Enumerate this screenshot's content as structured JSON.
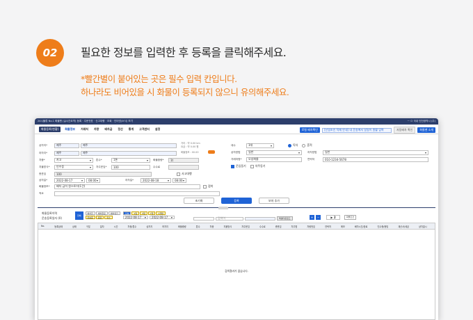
{
  "step": {
    "number": "02",
    "title": "필요한 정보를 입력한 후 등록을 클릭해주세요.",
    "note_line1": "*빨간별이 붙어있는 곳은 필수 입력 칸입니다.",
    "note_line2": "하나라도 비어있을 시 화물이 등록되지 않으니 유의해주세요."
  },
  "window": {
    "title_left": "24시물류 No.1 화물맨 (실시간요약) 등록 · 주문전표 · 신고대행 · 조회 · 인터넷(소식) 보기",
    "title_right": "ㅡ ㅁ 국내 인천광역시 (주)",
    "menu_active": "화물등록(현황)",
    "menus": [
      "화물정보",
      "거래처",
      "차량",
      "배차금",
      "정산",
      "통계",
      "고객센터",
      "설정"
    ],
    "menu_btn1": "로컬 배차확인",
    "search_text": "[신일조인 적재 안내] 내 운송에서 일일이 원활 입력",
    "menu_btn2": "자동배차 확인",
    "menu_btn3": "화물맨 소개"
  },
  "form": {
    "start_label": "상차지*",
    "start_v1": "제주",
    "start_v2": "제주",
    "end_label": "하차지*",
    "end_v1": "제주",
    "end_v2": "제주",
    "info1": "거리 : 약 0.00 km",
    "info2": "요금 : 약 0.00 원",
    "info3": "화물정보 : 00.00",
    "car_label": "차종*",
    "car_value": "카고",
    "ton_label": "톤수*",
    "ton_value": "1톤",
    "weight_label": "화물중량*",
    "weight_value": "1t",
    "pay_label": "지불방식*",
    "pay_value": "인수증",
    "fee_label": "차주운임*",
    "fee_value": "100",
    "commission_label": "수수료",
    "total_label": "총운임",
    "total_value": "100",
    "tax_label": "사고대행",
    "loadtime_label": "상차일*",
    "loadtime_date": "2022-08-17",
    "loadtime_hour": "08:00",
    "unloadtime_label": "하차일*",
    "unloadtime_date": "2022-08-18",
    "unloadtime_hour": "08:00",
    "cargo_label": "화물정보*",
    "cargo_value": "배차 급히 원스토어(1건)",
    "cargo_check": "접착",
    "memo_label": "적요",
    "r_class_label": "대수",
    "r_class_value": "1대",
    "r_radio1": "독차",
    "r_radio2": "혼적",
    "r_load_label": "상차방법",
    "r_load_value": "일반",
    "r_unload_label": "하차방법",
    "r_unload_value": "일반",
    "r_company_label": "거래처명*",
    "r_company_value": "오성화물",
    "r_phone_label": "연락처",
    "r_phone_value": "010-1234-5678",
    "r_check1": "운임동기",
    "r_check2": "차주동기"
  },
  "buttons": {
    "reset": "초기화",
    "register": "등록",
    "load_more": "보마 추가"
  },
  "lower": {
    "title": "화물등록이력",
    "search_label": "운송등록일자 (0)",
    "tag_all": "전체",
    "tags1": [
      "배차전",
      "배차완료",
      "배차대기"
    ],
    "tags2": [
      "운송중",
      "종료",
      "취소"
    ],
    "tags3": [
      "오늘",
      "1일",
      "3일",
      "7일",
      "1개월"
    ],
    "date_from": "2022-08-17",
    "date_to": "2022-08-17",
    "field_placeholder": "검색어",
    "excel_btn": "엑셀다운로드",
    "pager": "2",
    "print_btn": "화물조건",
    "columns": [
      "No.",
      "등록상태",
      "상태",
      "구분",
      "일자",
      "시간",
      "차종/톤수",
      "상차지",
      "하차지",
      "화물중량",
      "톤수",
      "차종",
      "지불방식",
      "차주운임",
      "수수료",
      "총운임",
      "차주명",
      "차량번호",
      "연락처",
      "메모",
      "배차시간/완료",
      "인수증/증빙",
      "계산서/세금",
      "상차일시"
    ],
    "empty": "검색결과가 없습니다."
  }
}
